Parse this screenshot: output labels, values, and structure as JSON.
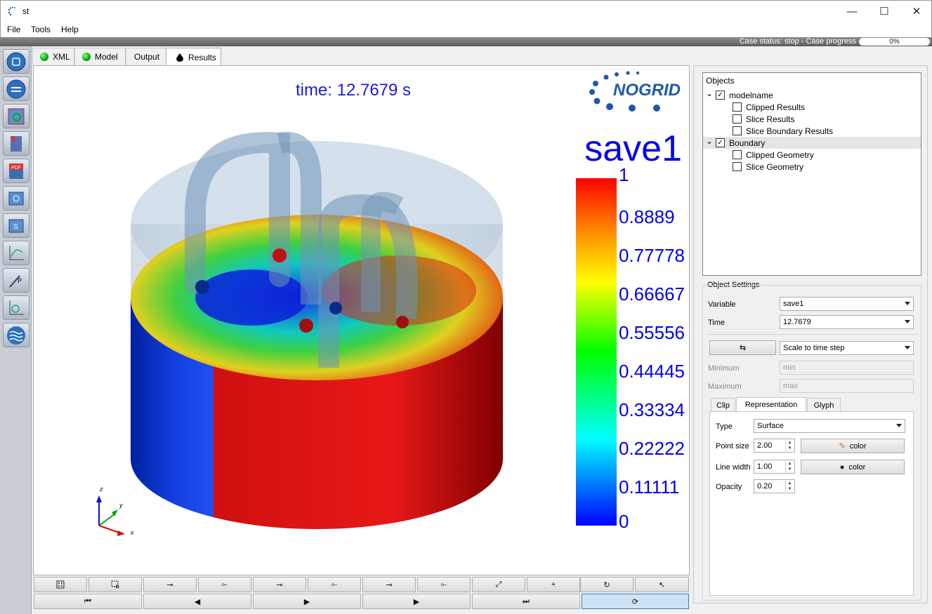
{
  "window": {
    "title": "st",
    "minimize": "—",
    "maximize": "☐",
    "close": "✕"
  },
  "menu": [
    "File",
    "Tools",
    "Help"
  ],
  "status": {
    "text": "Case status: stop - Case progress",
    "progress": "0%",
    "progress_value": 0
  },
  "tabs": [
    {
      "label": "XML",
      "icon": "green-dot-icon"
    },
    {
      "label": "Model",
      "icon": "green-dot-icon"
    },
    {
      "label": "Output",
      "icon": ""
    },
    {
      "label": "Results",
      "icon": "drop-icon"
    }
  ],
  "toolbar_icons": [
    "home-icon",
    "refresh-icon",
    "grid-search-icon",
    "notes-icon",
    "pdf-icon",
    "screenshot-icon",
    "screenshot-settings-icon",
    "xy-plot-icon",
    "probe-icon",
    "time-plot-icon",
    "flow-icon"
  ],
  "viewport": {
    "time_label": "time: 12.7679 s",
    "logo": "NOGRID",
    "variable_title": "save1",
    "colorbar_labels": [
      "1",
      "0.8889",
      "0.77778",
      "0.66667",
      "0.55556",
      "0.44445",
      "0.33334",
      "0.22222",
      "0.11111",
      "0"
    ],
    "colorbar_range": [
      0,
      1
    ],
    "axes": {
      "x": "x",
      "y": "y",
      "z": "z"
    }
  },
  "view_buttons": [
    "reset-view-icon",
    "zoom-box-icon",
    "view-x-plus-icon",
    "view-x-minus-icon",
    "view-y-plus-icon",
    "view-y-minus-icon",
    "view-z-plus-icon",
    "view-z-minus-icon",
    "rotate-x-icon",
    "rotate-y-icon",
    "rotate-icon",
    "pick-icon"
  ],
  "playback": {
    "first": "⏮",
    "prev": "◀",
    "play": "▶",
    "next": "▶",
    "last": "⏭",
    "loop": "⟳"
  },
  "objects": {
    "title": "Objects",
    "tree": [
      {
        "label": "modelname",
        "checked": true,
        "level": 0,
        "expandable": true
      },
      {
        "label": "Clipped Results",
        "checked": false,
        "level": 1
      },
      {
        "label": "Slice Results",
        "checked": false,
        "level": 1
      },
      {
        "label": "Slice Boundary Results",
        "checked": false,
        "level": 1
      },
      {
        "label": "Boundary",
        "checked": true,
        "level": 0,
        "expandable": true,
        "selected": true
      },
      {
        "label": "Clipped Geometry",
        "checked": false,
        "level": 1
      },
      {
        "label": "Slice Geometry",
        "checked": false,
        "level": 1
      }
    ]
  },
  "settings": {
    "title": "Object Settings",
    "variable_label": "Variable",
    "variable_value": "save1",
    "time_label": "Time",
    "time_value": "12.7679",
    "scale_value": "Scale to time step",
    "min_label": "Minimum",
    "min_placeholder": "min",
    "max_label": "Maximum",
    "max_placeholder": "max",
    "inner_tabs": [
      "Clip",
      "Representation",
      "Glyph"
    ],
    "type_label": "Type",
    "type_value": "Surface",
    "point_size_label": "Point size",
    "point_size_value": "2.00",
    "line_width_label": "Line width",
    "line_width_value": "1.00",
    "opacity_label": "Opacity",
    "opacity_value": "0.20",
    "color_label": "color"
  }
}
